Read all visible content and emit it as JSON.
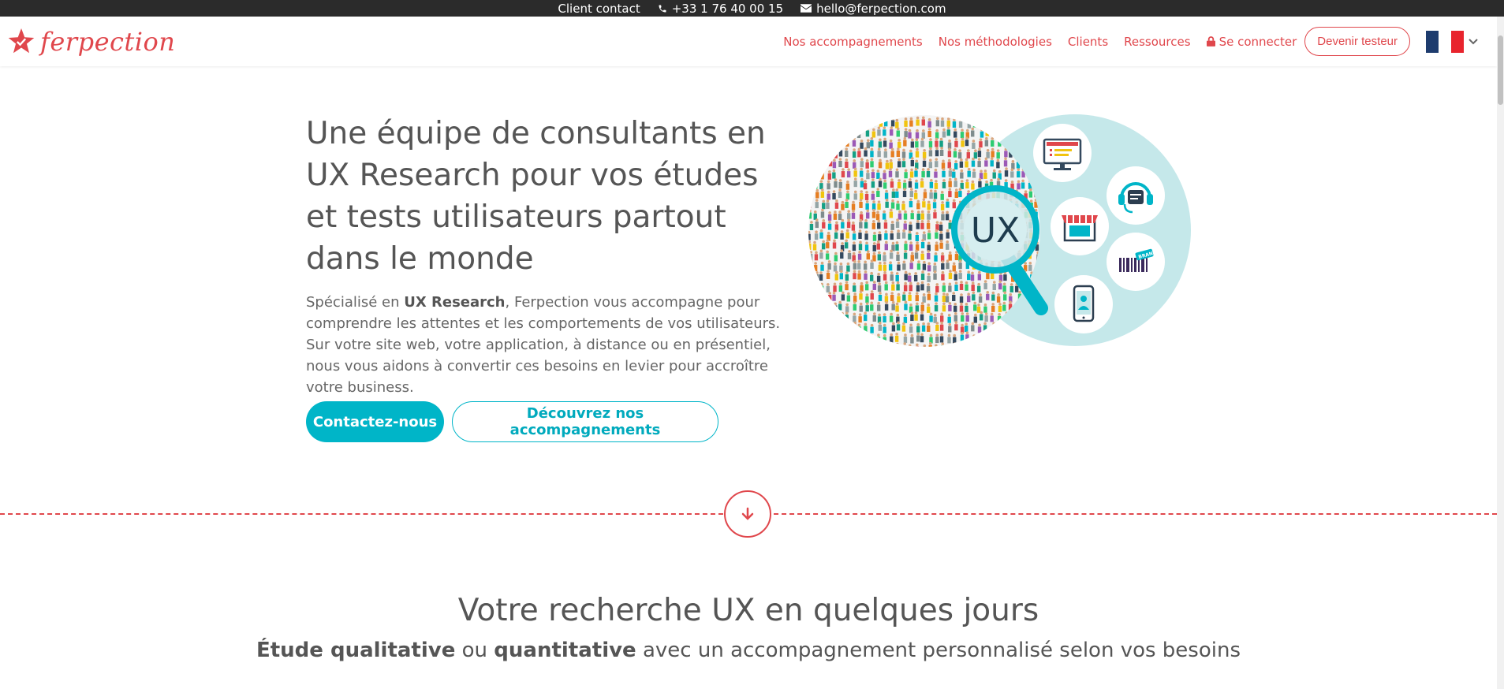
{
  "topbar": {
    "client_contact": "Client contact",
    "phone": "+33 1 76 40 00 15",
    "email": "hello@ferpection.com"
  },
  "header": {
    "logo_text": "ferpection",
    "nav": [
      {
        "label": "Nos accompagnements"
      },
      {
        "label": "Nos méthodologies"
      },
      {
        "label": "Clients"
      },
      {
        "label": "Ressources"
      },
      {
        "label": "Se connecter"
      }
    ],
    "cta_label": "Devenir testeur",
    "language_flag": "fr"
  },
  "hero": {
    "title": "Une équipe de consultants en UX Research pour vos études et tests utilisateurs partout dans le monde",
    "desc_prefix": "Spécialisé en ",
    "desc_bold": "UX Research",
    "desc_rest": ", Ferpection vous accompagne pour comprendre les attentes et les comportements de vos utilisateurs. Sur votre site web, votre application, à distance ou en présentiel, nous vous aidons à convertir ces besoins en levier pour accroître votre business.",
    "primary_button": "Contactez-nous",
    "secondary_button": "Découvrez nos accompagnements",
    "illustration": {
      "lens_text": "UX",
      "tag_text": "BRAND"
    }
  },
  "section2": {
    "title": "Votre recherche UX en quelques jours",
    "sub_bold1": "Étude qualitative",
    "sub_mid": " ou ",
    "sub_bold2": "quantitative",
    "sub_rest": " avec un accompagnement personnalisé selon vos besoins"
  },
  "colors": {
    "brand_red": "#e0474c",
    "accent_teal": "#00b5c8",
    "topbar_bg": "#2b2b2b",
    "illustration_bg": "#c5e8ea"
  }
}
